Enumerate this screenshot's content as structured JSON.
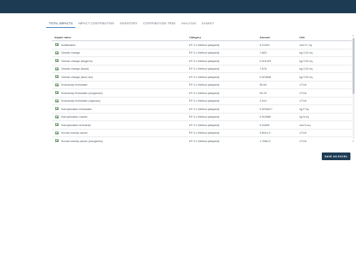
{
  "tabs": [
    {
      "label": "TOTAL IMPACTS"
    },
    {
      "label": "IMPACT CONTRIBUTION"
    },
    {
      "label": "INVENTORY"
    },
    {
      "label": "CONTRIBUTION TREE"
    },
    {
      "label": "ANALYSIS"
    },
    {
      "label": "SANKEY"
    }
  ],
  "active_tab": "TOTAL IMPACTS",
  "table": {
    "headers": {
      "name": "Impact name",
      "category": "Category",
      "amount": "Amount",
      "unit": "Unit"
    },
    "rows": [
      {
        "name": "Acidification",
        "category": "EF 3.1 Method (adapted)",
        "amount": "0.01924",
        "unit": "mol H+ eq"
      },
      {
        "name": "Climate change",
        "category": "EF 3.1 Method (adapted)",
        "amount": "7.883",
        "unit": "kg CO2 eq"
      },
      {
        "name": "Climate change (biogenic)",
        "category": "EF 3.1 Method (adapted)",
        "amount": "0.001429",
        "unit": "kg CO2 eq"
      },
      {
        "name": "Climate change (fossil)",
        "category": "EF 3.1 Method (adapted)",
        "amount": "7.878",
        "unit": "kg CO2 eq"
      },
      {
        "name": "Climate change (land use)",
        "category": "EF 3.1 Method (adapted)",
        "amount": "0.003848",
        "unit": "kg CO2 eq"
      },
      {
        "name": "Ecotoxicity freshwater",
        "category": "EF 3.1 Method (adapted)",
        "amount": "55.80",
        "unit": "CTUe"
      },
      {
        "name": "Ecotoxicity freshwater (inorganics)",
        "category": "EF 3.1 Method (adapted)",
        "amount": "53.25",
        "unit": "CTUe"
      },
      {
        "name": "Ecotoxicity freshwater (organics)",
        "category": "EF 3.1 Method (adapted)",
        "amount": "2.444",
        "unit": "CTUe"
      },
      {
        "name": "Eutrophication freshwater",
        "category": "EF 3.1 Method (adapted)",
        "amount": "0.0006117",
        "unit": "kg P eq"
      },
      {
        "name": "Eutrophication marine",
        "category": "EF 3.1 Method (adapted)",
        "amount": "0.004580",
        "unit": "kg N eq"
      },
      {
        "name": "Eutrophication terrestrial",
        "category": "EF 3.1 Method (adapted)",
        "amount": "0.04826",
        "unit": "mol N eq"
      },
      {
        "name": "Human toxicity cancer",
        "category": "EF 3.1 Method (adapted)",
        "amount": "3.861e-9",
        "unit": "CTUh"
      },
      {
        "name": "Human toxicity cancer (inorganics)",
        "category": "EF 3.1 Method (adapted)",
        "amount": "1.785e-9",
        "unit": "CTUh"
      }
    ]
  },
  "save_button": {
    "label": "SAVE AS EXCEL"
  },
  "colors": {
    "header_bar": "#1d3b53",
    "accent": "#2b73b5",
    "button": "#1d3b53"
  },
  "icons": {
    "row_icon": "impact-category-icon"
  }
}
